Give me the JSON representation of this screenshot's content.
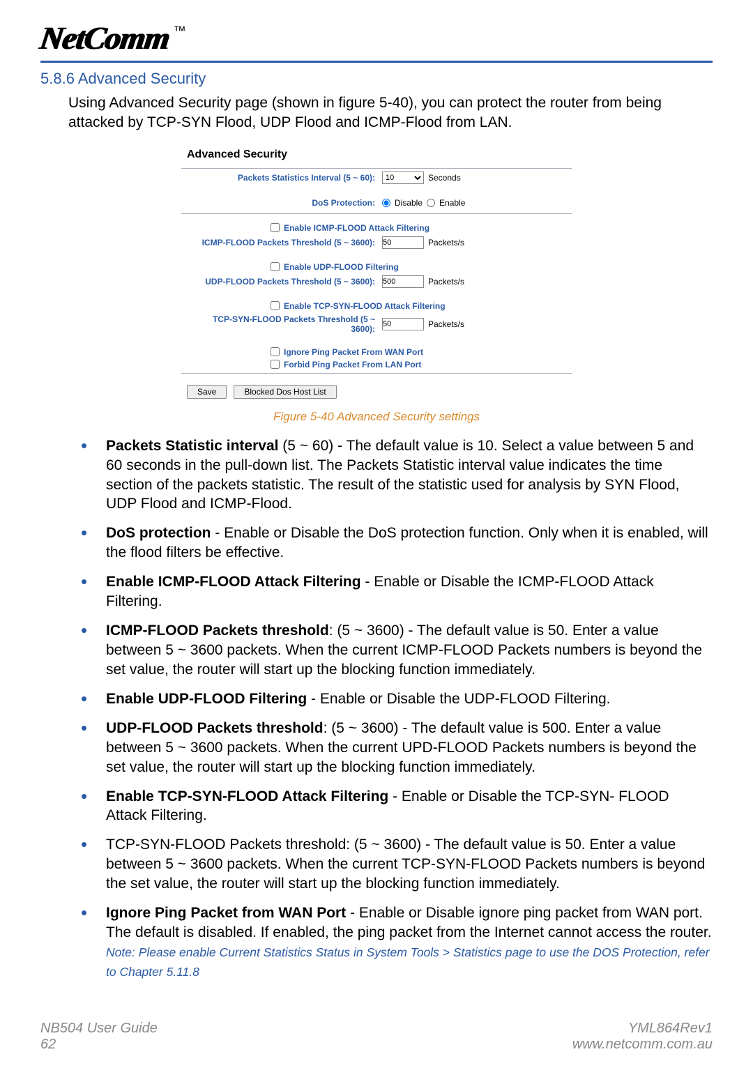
{
  "logo": {
    "brand": "NetComm",
    "tm": "™"
  },
  "section": {
    "heading": "5.8.6 Advanced Security"
  },
  "intro": "Using Advanced Security page (shown in figure 5-40), you can protect the router from being attacked by TCP-SYN Flood, UDP Flood and ICMP-Flood from LAN.",
  "shot": {
    "title": "Advanced Security",
    "statInterval": {
      "label": "Packets Statistics Interval (5 ~ 60):",
      "value": "10",
      "unit": "Seconds"
    },
    "dos": {
      "label": "DoS Protection:",
      "disable": "Disable",
      "enable": "Enable"
    },
    "icmpFilter": {
      "chk": "Enable ICMP-FLOOD Attack Filtering",
      "label": "ICMP-FLOOD Packets Threshold (5 ~ 3600):",
      "value": "50",
      "unit": "Packets/s"
    },
    "udpFilter": {
      "chk": "Enable UDP-FLOOD Filtering",
      "label": "UDP-FLOOD Packets Threshold (5 ~ 3600):",
      "value": "500",
      "unit": "Packets/s"
    },
    "tcpFilter": {
      "chk": "Enable TCP-SYN-FLOOD Attack Filtering",
      "label": "TCP-SYN-FLOOD Packets Threshold (5 ~ 3600):",
      "value": "50",
      "unit": "Packets/s"
    },
    "ignorePing": "Ignore Ping Packet From WAN Port",
    "forbidPing": "Forbid Ping Packet From LAN Port",
    "save": "Save",
    "blocked": "Blocked Dos Host List"
  },
  "figcap": "Figure 5-40 Advanced Security settings",
  "bullets": {
    "b1_bold": "Packets Statistic interval",
    "b1_rest": " (5 ~ 60) - The default value is 10. Select a value between 5 and 60 seconds in the pull-down list. The Packets Statistic interval value indicates the time section of the packets statistic. The result of the statistic used for analysis by SYN Flood, UDP Flood and ICMP-Flood.",
    "b2_bold": "DoS protection",
    "b2_rest": " - Enable or Disable the DoS protection function. Only when it is enabled, will the flood filters be effective.",
    "b3_bold": "Enable ICMP-FLOOD Attack Filtering",
    "b3_rest": " - Enable or Disable the ICMP-FLOOD Attack Filtering.",
    "b4_bold": "ICMP-FLOOD Packets threshold",
    "b4_rest": ": (5 ~ 3600) - The default value is 50. Enter a value between 5 ~ 3600 packets. When the current ICMP-FLOOD Packets numbers is beyond the set value, the router will start up the blocking function immediately.",
    "b5_bold": "Enable UDP-FLOOD Filtering",
    "b5_rest": " - Enable or Disable the UDP-FLOOD Filtering.",
    "b6_bold": "UDP-FLOOD Packets threshold",
    "b6_rest": ": (5 ~ 3600) - The default value is 500. Enter a value between 5 ~ 3600 packets. When the current UPD-FLOOD Packets numbers is beyond the set value, the router will start up the blocking function immediately.",
    "b7_bold": "Enable TCP-SYN-FLOOD Attack Filtering",
    "b7_rest": " - Enable or Disable the TCP-SYN- FLOOD Attack Filtering.",
    "b8_rest": "TCP-SYN-FLOOD Packets threshold: (5 ~ 3600) - The default value is 50. Enter a value between 5 ~ 3600 packets. When the current TCP-SYN-FLOOD Packets numbers is beyond the set value, the router will start up the blocking function immediately.",
    "b9_bold": "Ignore Ping Packet from WAN Port",
    "b9_rest": " - Enable or Disable ignore ping packet from WAN port. The default is disabled. If enabled, the ping packet from the Internet cannot access the router.",
    "note": "Note: Please enable Current Statistics Status in System Tools > Statistics page to use the DOS Protection, refer to Chapter 5.11.8"
  },
  "footer": {
    "left1": "NB504 User Guide",
    "left2": "62",
    "right1": "YML864Rev1",
    "right2": "www.netcomm.com.au"
  }
}
